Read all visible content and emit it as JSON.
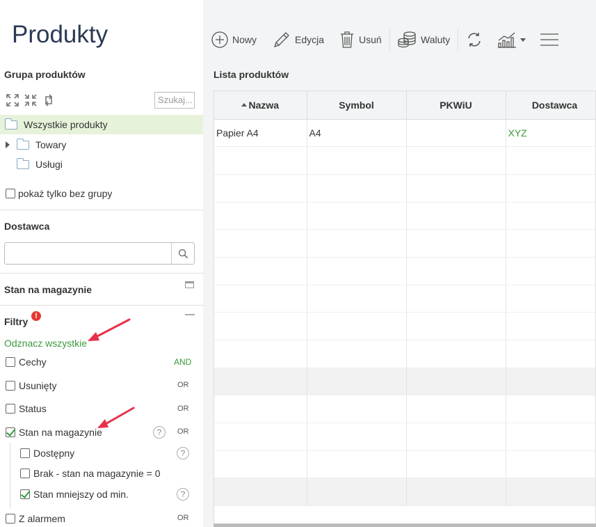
{
  "page": {
    "title": "Produkty"
  },
  "left": {
    "group_section": {
      "title": "Grupa produktów",
      "search_placeholder": "Szukaj...",
      "tree": [
        {
          "label": "Wszystkie produkty",
          "selected": true
        },
        {
          "label": "Towary",
          "expandable": true
        },
        {
          "label": "Usługi"
        }
      ],
      "only_without_group": "pokaż tylko bez grupy"
    },
    "supplier_section": {
      "title": "Dostawca",
      "value": ""
    },
    "stock_section": {
      "title": "Stan na magazynie"
    },
    "filters": {
      "title": "Filtry",
      "alert": "!",
      "select_all": "Odznacz wszystkie",
      "items": [
        {
          "label": "Cechy",
          "op": "AND",
          "checked": false
        },
        {
          "label": "Usunięty",
          "op": "OR",
          "checked": false
        },
        {
          "label": "Status",
          "op": "OR",
          "checked": false
        },
        {
          "label": "Stan na magazynie",
          "op": "OR",
          "checked": true,
          "help": "?"
        },
        {
          "label": "Dostępny",
          "checked": false,
          "help": "?"
        },
        {
          "label": "Brak - stan na magazynie = 0",
          "checked": false
        },
        {
          "label": "Stan mniejszy od min.",
          "checked": true,
          "help": "?"
        },
        {
          "label": "Z alarmem",
          "op": "OR",
          "checked": false
        }
      ]
    }
  },
  "toolbar": {
    "new": "Nowy",
    "edit": "Edycja",
    "delete": "Usuń",
    "currencies": "Waluty"
  },
  "list": {
    "title": "Lista produktów",
    "columns": [
      "Nazwa",
      "Symbol",
      "PKWiU",
      "Dostawca"
    ],
    "rows": [
      [
        "Papier A4",
        "A4",
        "",
        "XYZ"
      ]
    ]
  },
  "colors": {
    "accent_green": "#3a9a3a",
    "selected_bg": "#e6f2da",
    "alert_red": "#e53935"
  }
}
